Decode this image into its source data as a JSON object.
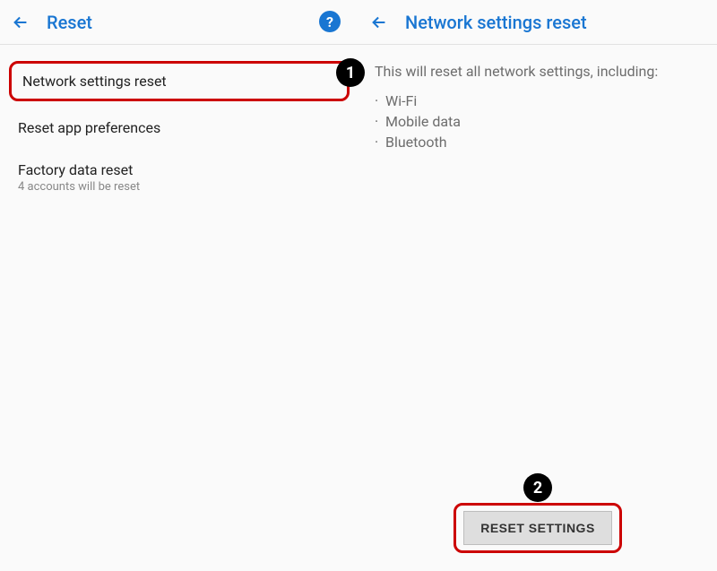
{
  "left": {
    "header_title": "Reset",
    "help_label": "?",
    "items": [
      {
        "title": "Network settings reset",
        "sub": ""
      },
      {
        "title": "Reset app preferences",
        "sub": ""
      },
      {
        "title": "Factory data reset",
        "sub": "4 accounts will be reset"
      }
    ],
    "badge_1": "1"
  },
  "right": {
    "header_title": "Network settings reset",
    "description": "This will reset all network settings, including:",
    "bullets": [
      "Wi-Fi",
      "Mobile data",
      "Bluetooth"
    ],
    "reset_button": "RESET SETTINGS",
    "badge_2": "2"
  }
}
